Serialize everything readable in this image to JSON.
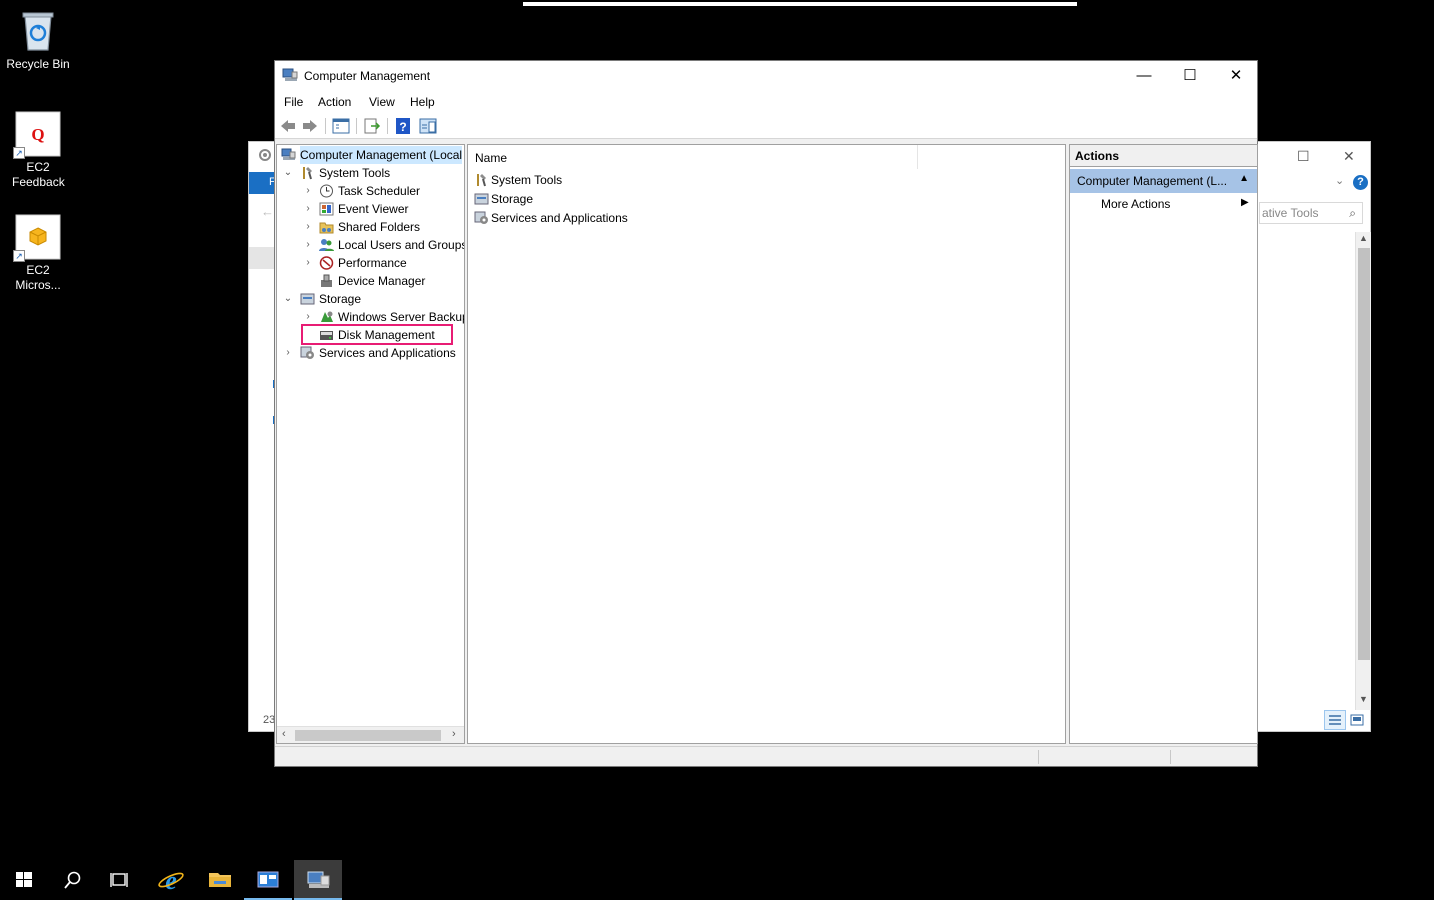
{
  "desktop": {
    "icons": [
      {
        "label": "Recycle Bin"
      },
      {
        "label": "EC2 Feedback"
      },
      {
        "label": "EC2 Micros..."
      }
    ]
  },
  "background_window": {
    "left_tab_label": "F",
    "search_placeholder": "ative Tools",
    "bottom_left_text": "23"
  },
  "window": {
    "title": "Computer Management",
    "menu": [
      "File",
      "Action",
      "View",
      "Help"
    ],
    "tree": {
      "root": "Computer Management (Local",
      "system_tools": "System Tools",
      "task_scheduler": "Task Scheduler",
      "event_viewer": "Event Viewer",
      "shared_folders": "Shared Folders",
      "local_users": "Local Users and Groups",
      "performance": "Performance",
      "device_manager": "Device Manager",
      "storage": "Storage",
      "windows_server_backup": "Windows Server Backup",
      "disk_management": "Disk Management",
      "services_apps": "Services and Applications"
    },
    "center": {
      "column_name": "Name",
      "items": [
        "System Tools",
        "Storage",
        "Services and Applications"
      ]
    },
    "actions": {
      "header": "Actions",
      "section": "Computer Management (L...",
      "more_actions": "More Actions"
    }
  },
  "colors": {
    "highlight_border": "#e81c74",
    "selection": "#cce8ff",
    "actions_section_bg": "#a6c3e6"
  }
}
